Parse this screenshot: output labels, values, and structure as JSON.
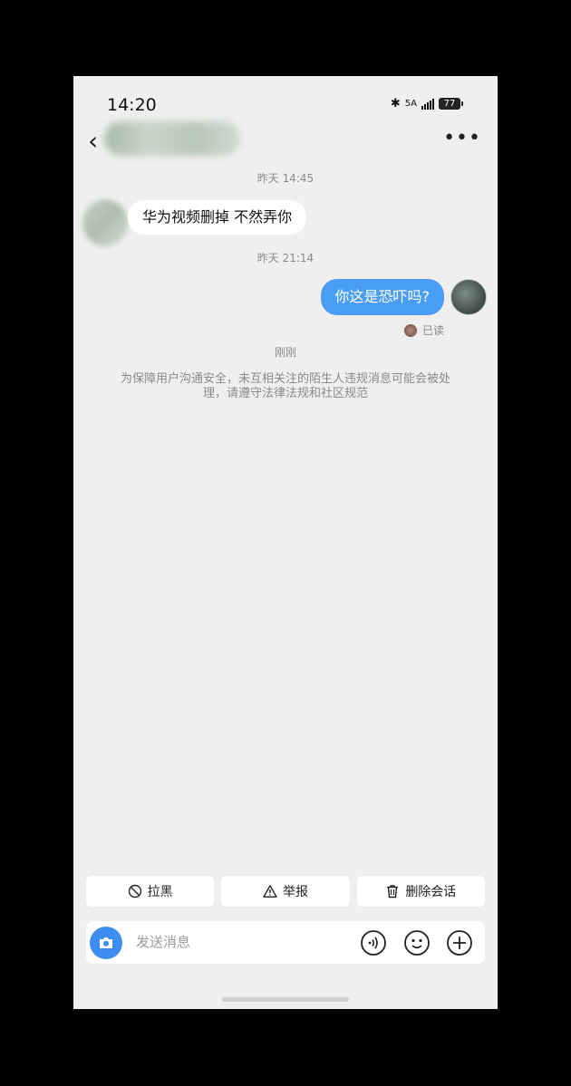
{
  "status": {
    "time": "14:20",
    "network": "5A",
    "battery": "77"
  },
  "header": {
    "back_icon": "chevron-left-icon",
    "more_icon": "more-icon"
  },
  "messages": {
    "ts1": "昨天 14:45",
    "msg1": "华为视频删掉 不然弄你",
    "ts2": "昨天 21:14",
    "msg2": "你这是恐吓吗?",
    "read": "已读",
    "ts3": "刚刚",
    "notice": "为保障用户沟通安全，未互相关注的陌生人违规消息可能会被处理，请遵守法律法规和社区规范"
  },
  "actions": {
    "block": "拉黑",
    "report": "举报",
    "delete": "删除会话"
  },
  "input": {
    "placeholder": "发送消息"
  },
  "colors": {
    "accent": "#4a9df6",
    "camera": "#3d8ef0"
  }
}
